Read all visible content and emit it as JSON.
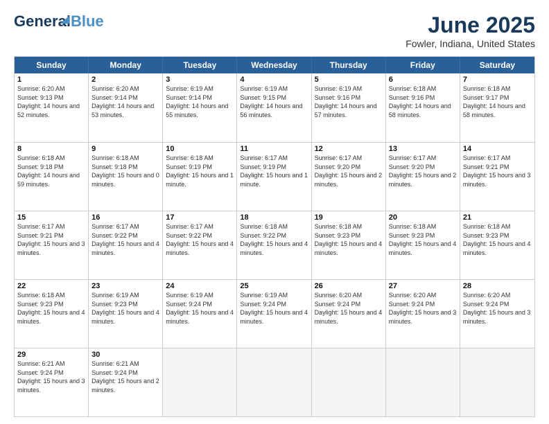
{
  "header": {
    "logo_line1": "General",
    "logo_line2": "Blue",
    "title": "June 2025",
    "location": "Fowler, Indiana, United States"
  },
  "days_of_week": [
    "Sunday",
    "Monday",
    "Tuesday",
    "Wednesday",
    "Thursday",
    "Friday",
    "Saturday"
  ],
  "weeks": [
    [
      {
        "day": 1,
        "rise": "6:20 AM",
        "set": "9:13 PM",
        "daylight": "14 hours and 52 minutes."
      },
      {
        "day": 2,
        "rise": "6:20 AM",
        "set": "9:14 PM",
        "daylight": "14 hours and 53 minutes."
      },
      {
        "day": 3,
        "rise": "6:19 AM",
        "set": "9:14 PM",
        "daylight": "14 hours and 55 minutes."
      },
      {
        "day": 4,
        "rise": "6:19 AM",
        "set": "9:15 PM",
        "daylight": "14 hours and 56 minutes."
      },
      {
        "day": 5,
        "rise": "6:19 AM",
        "set": "9:16 PM",
        "daylight": "14 hours and 57 minutes."
      },
      {
        "day": 6,
        "rise": "6:18 AM",
        "set": "9:16 PM",
        "daylight": "14 hours and 58 minutes."
      },
      {
        "day": 7,
        "rise": "6:18 AM",
        "set": "9:17 PM",
        "daylight": "14 hours and 58 minutes."
      }
    ],
    [
      {
        "day": 8,
        "rise": "6:18 AM",
        "set": "9:18 PM",
        "daylight": "14 hours and 59 minutes."
      },
      {
        "day": 9,
        "rise": "6:18 AM",
        "set": "9:18 PM",
        "daylight": "15 hours and 0 minutes."
      },
      {
        "day": 10,
        "rise": "6:18 AM",
        "set": "9:19 PM",
        "daylight": "15 hours and 1 minute."
      },
      {
        "day": 11,
        "rise": "6:17 AM",
        "set": "9:19 PM",
        "daylight": "15 hours and 1 minute."
      },
      {
        "day": 12,
        "rise": "6:17 AM",
        "set": "9:20 PM",
        "daylight": "15 hours and 2 minutes."
      },
      {
        "day": 13,
        "rise": "6:17 AM",
        "set": "9:20 PM",
        "daylight": "15 hours and 2 minutes."
      },
      {
        "day": 14,
        "rise": "6:17 AM",
        "set": "9:21 PM",
        "daylight": "15 hours and 3 minutes."
      }
    ],
    [
      {
        "day": 15,
        "rise": "6:17 AM",
        "set": "9:21 PM",
        "daylight": "15 hours and 3 minutes."
      },
      {
        "day": 16,
        "rise": "6:17 AM",
        "set": "9:22 PM",
        "daylight": "15 hours and 4 minutes."
      },
      {
        "day": 17,
        "rise": "6:17 AM",
        "set": "9:22 PM",
        "daylight": "15 hours and 4 minutes."
      },
      {
        "day": 18,
        "rise": "6:18 AM",
        "set": "9:22 PM",
        "daylight": "15 hours and 4 minutes."
      },
      {
        "day": 19,
        "rise": "6:18 AM",
        "set": "9:23 PM",
        "daylight": "15 hours and 4 minutes."
      },
      {
        "day": 20,
        "rise": "6:18 AM",
        "set": "9:23 PM",
        "daylight": "15 hours and 4 minutes."
      },
      {
        "day": 21,
        "rise": "6:18 AM",
        "set": "9:23 PM",
        "daylight": "15 hours and 4 minutes."
      }
    ],
    [
      {
        "day": 22,
        "rise": "6:18 AM",
        "set": "9:23 PM",
        "daylight": "15 hours and 4 minutes."
      },
      {
        "day": 23,
        "rise": "6:19 AM",
        "set": "9:23 PM",
        "daylight": "15 hours and 4 minutes."
      },
      {
        "day": 24,
        "rise": "6:19 AM",
        "set": "9:24 PM",
        "daylight": "15 hours and 4 minutes."
      },
      {
        "day": 25,
        "rise": "6:19 AM",
        "set": "9:24 PM",
        "daylight": "15 hours and 4 minutes."
      },
      {
        "day": 26,
        "rise": "6:20 AM",
        "set": "9:24 PM",
        "daylight": "15 hours and 4 minutes."
      },
      {
        "day": 27,
        "rise": "6:20 AM",
        "set": "9:24 PM",
        "daylight": "15 hours and 3 minutes."
      },
      {
        "day": 28,
        "rise": "6:20 AM",
        "set": "9:24 PM",
        "daylight": "15 hours and 3 minutes."
      }
    ],
    [
      {
        "day": 29,
        "rise": "6:21 AM",
        "set": "9:24 PM",
        "daylight": "15 hours and 3 minutes."
      },
      {
        "day": 30,
        "rise": "6:21 AM",
        "set": "9:24 PM",
        "daylight": "15 hours and 2 minutes."
      },
      null,
      null,
      null,
      null,
      null
    ]
  ]
}
